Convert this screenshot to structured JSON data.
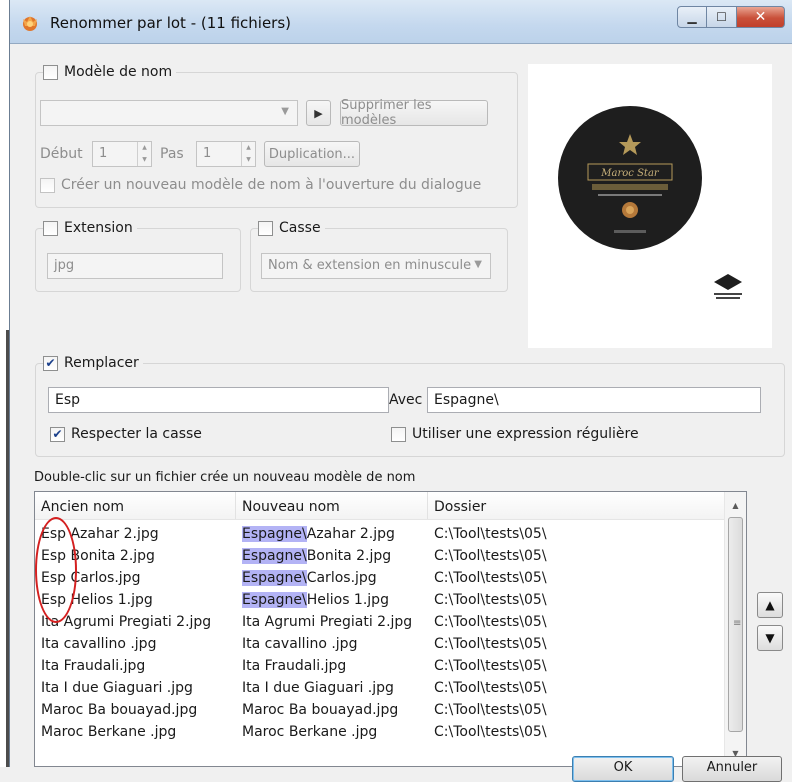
{
  "window": {
    "title": "Renommer par lot - (11 fichiers)",
    "controls": {
      "close": "✕"
    }
  },
  "modele": {
    "label": "Modèle de nom",
    "checked": false,
    "select_value": "",
    "delete_button": "Supprimer les modèles",
    "debut_label": "Début",
    "debut_value": "1",
    "pas_label": "Pas",
    "pas_value": "1",
    "duplication_button": "Duplication...",
    "create_option": "Créer un nouveau modèle de nom à l'ouverture du dialogue"
  },
  "extension": {
    "label": "Extension",
    "checked": false,
    "value": "jpg"
  },
  "casse": {
    "label": "Casse",
    "checked": false,
    "selected": "Nom & extension en minuscule"
  },
  "remplacer": {
    "label": "Remplacer",
    "checked": true,
    "search_value": "Esp",
    "avec_label": "Avec",
    "replace_value": "Espagne\\",
    "match_case_label": "Respecter la casse",
    "match_case_checked": true,
    "regex_label": "Utiliser une expression régulière",
    "regex_checked": false
  },
  "hint": "Double-clic sur un fichier crée un nouveau modèle de nom",
  "files": {
    "columns": [
      "Ancien nom",
      "Nouveau nom",
      "Dossier"
    ],
    "rows": [
      {
        "old": "Esp Azahar 2.jpg",
        "new_prefix": "Espagne\\",
        "new_rest": "Azahar 2.jpg",
        "folder": "C:\\Tool\\tests\\05\\"
      },
      {
        "old": "Esp Bonita 2.jpg",
        "new_prefix": "Espagne\\",
        "new_rest": "Bonita 2.jpg",
        "folder": "C:\\Tool\\tests\\05\\"
      },
      {
        "old": "Esp Carlos.jpg",
        "new_prefix": "Espagne\\",
        "new_rest": "Carlos.jpg",
        "folder": "C:\\Tool\\tests\\05\\"
      },
      {
        "old": "Esp Helios 1.jpg",
        "new_prefix": "Espagne\\",
        "new_rest": "Helios 1.jpg",
        "folder": "C:\\Tool\\tests\\05\\"
      },
      {
        "old": "Ita Agrumi Pregiati 2.jpg",
        "new_prefix": "",
        "new_rest": "Ita Agrumi Pregiati 2.jpg",
        "folder": "C:\\Tool\\tests\\05\\"
      },
      {
        "old": "Ita cavallino .jpg",
        "new_prefix": "",
        "new_rest": "Ita cavallino .jpg",
        "folder": "C:\\Tool\\tests\\05\\"
      },
      {
        "old": "Ita Fraudali.jpg",
        "new_prefix": "",
        "new_rest": "Ita Fraudali.jpg",
        "folder": "C:\\Tool\\tests\\05\\"
      },
      {
        "old": "Ita I due Giaguari .jpg",
        "new_prefix": "",
        "new_rest": "Ita I due Giaguari .jpg",
        "folder": "C:\\Tool\\tests\\05\\"
      },
      {
        "old": "Maroc Ba bouayad.jpg",
        "new_prefix": "",
        "new_rest": "Maroc Ba bouayad.jpg",
        "folder": "C:\\Tool\\tests\\05\\"
      },
      {
        "old": "Maroc Berkane .jpg",
        "new_prefix": "",
        "new_rest": "Maroc Berkane .jpg",
        "folder": "C:\\Tool\\tests\\05\\"
      }
    ]
  },
  "preview": {
    "logo_text": "Maroc Star",
    "colors": {
      "disc": "#1e1e1e",
      "gold": "#b59a5a"
    }
  },
  "bottom": {
    "ok": "OK",
    "cancel": "Annuler"
  },
  "colors": {
    "highlight": "#b3b3f5",
    "annotation": "#d42020"
  }
}
